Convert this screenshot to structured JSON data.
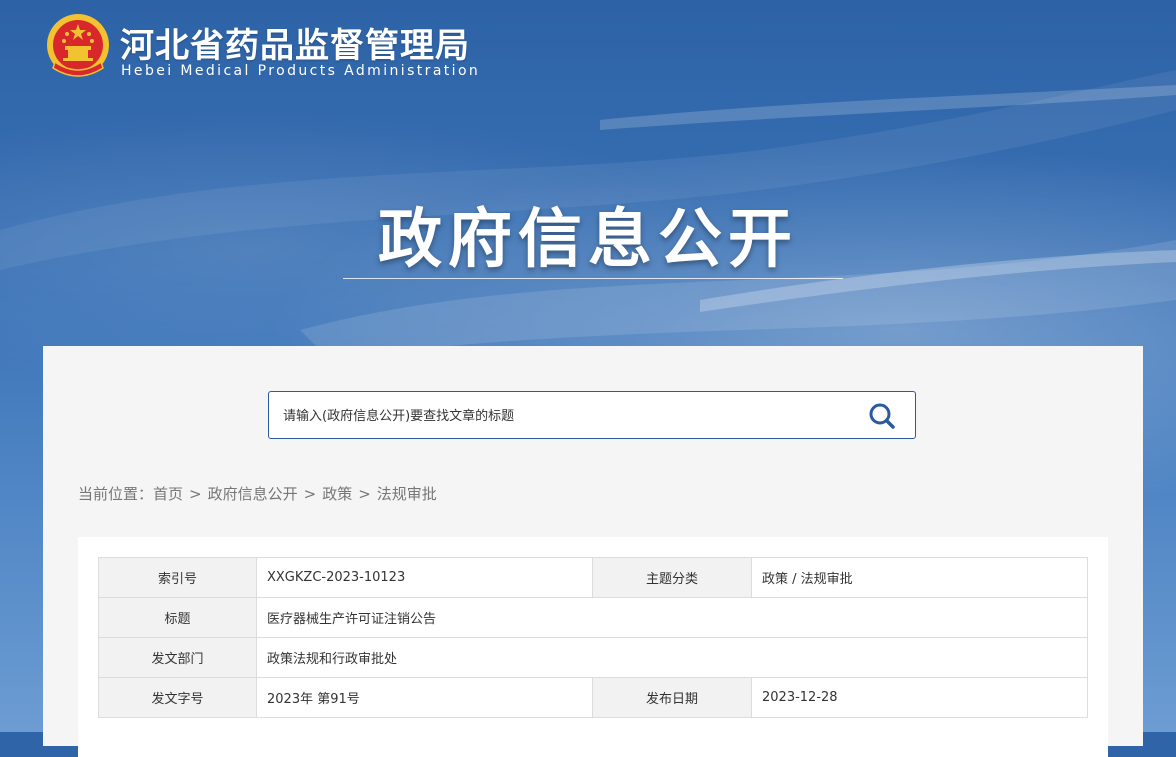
{
  "header": {
    "site_name": "河北省药品监督管理局",
    "site_subtitle": "Hebei Medical Products Administration",
    "emblem_icon": "national-emblem-icon"
  },
  "banner": {
    "title": "政府信息公开"
  },
  "search": {
    "placeholder": "请输入(政府信息公开)要查找文章的标题",
    "icon": "search-icon"
  },
  "breadcrumb": {
    "prefix": "当前位置：",
    "items": [
      "首页",
      "政府信息公开",
      "政策",
      "法规审批"
    ],
    "separator": ">"
  },
  "info_table": {
    "index_label": "索引号",
    "index_value": "XXGKZC-2023-10123",
    "category_label": "主题分类",
    "category_value": "政策 / 法规审批",
    "title_label": "标题",
    "title_value": "医疗器械生产许可证注销公告",
    "dept_label": "发文部门",
    "dept_value": "政策法规和行政审批处",
    "doc_no_label": "发文字号",
    "doc_no_value": "2023年 第91号",
    "date_label": "发布日期",
    "date_value": "2023-12-28"
  },
  "colors": {
    "banner_blue": "#2f65a8",
    "accent_blue": "#2a5aa0",
    "emblem_red": "#d8282c",
    "emblem_gold": "#f2c230"
  }
}
